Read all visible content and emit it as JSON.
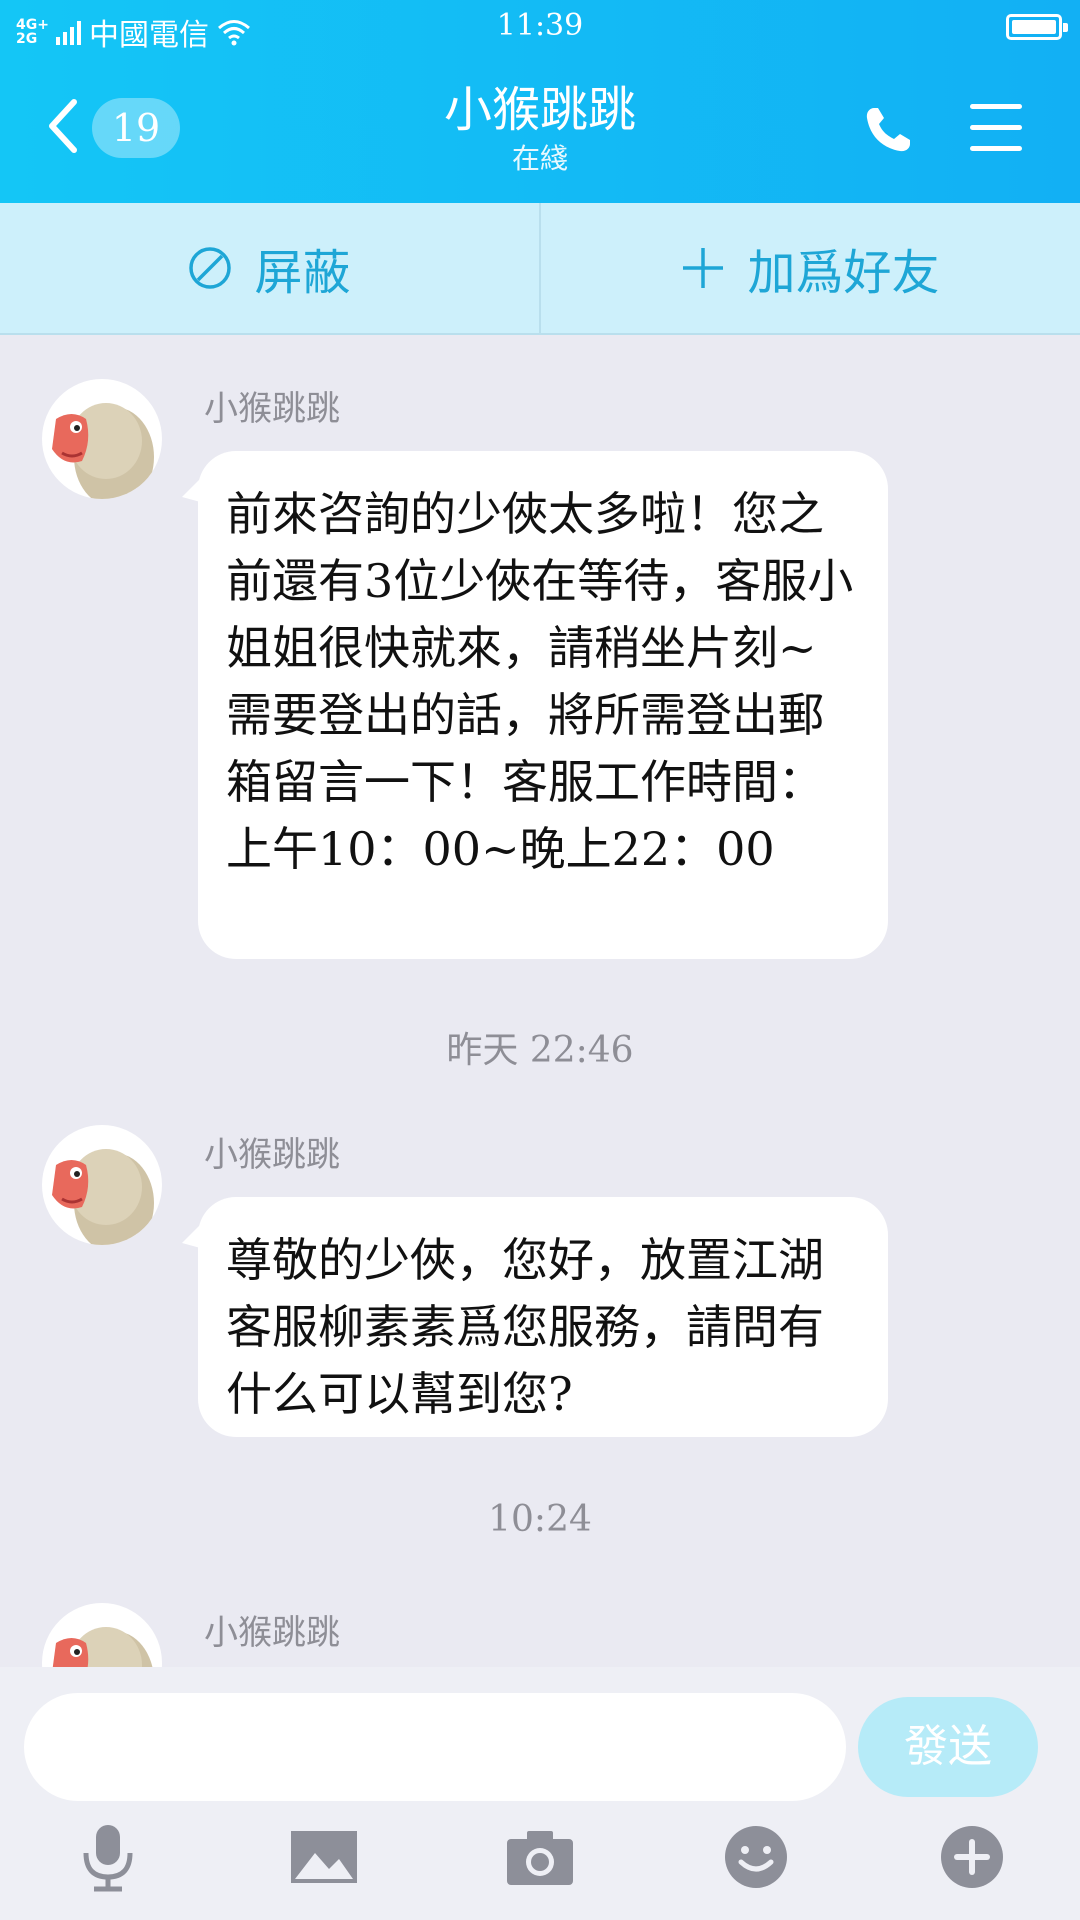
{
  "status_bar": {
    "network": "4G+ 2G",
    "carrier": "中國電信",
    "time": "11:39"
  },
  "header": {
    "unread_count": "19",
    "title": "小猴跳跳",
    "subtitle": "在綫"
  },
  "actions": {
    "block_label": "屏蔽",
    "add_friend_label": "加爲好友"
  },
  "messages": [
    {
      "sender": "小猴跳跳",
      "text": "前來咨詢的少俠太多啦！您之前還有3位少俠在等待，客服小姐姐很快就來，請稍坐片刻~需要登出的話，將所需登出郵箱留言一下！客服工作時間：上午10：00~晚上22：00"
    },
    {
      "timestamp": "昨天 22:46"
    },
    {
      "sender": "小猴跳跳",
      "text": "尊敬的少俠，您好，放置江湖客服柳素素爲您服務，請問有什么可以幫到您?"
    },
    {
      "timestamp": "10:24"
    },
    {
      "sender": "小猴跳跳"
    }
  ],
  "composer": {
    "placeholder": "",
    "send_label": "發送"
  },
  "toolbar": [
    "microphone-icon",
    "image-icon",
    "camera-icon",
    "emoji-icon",
    "plus-icon"
  ],
  "colors": {
    "header": "#14c6f6",
    "action_bar": "#cdf0fb",
    "accent": "#1ea6d6",
    "chat_bg": "#eaeaf2",
    "send_button": "#b6ebf8"
  }
}
